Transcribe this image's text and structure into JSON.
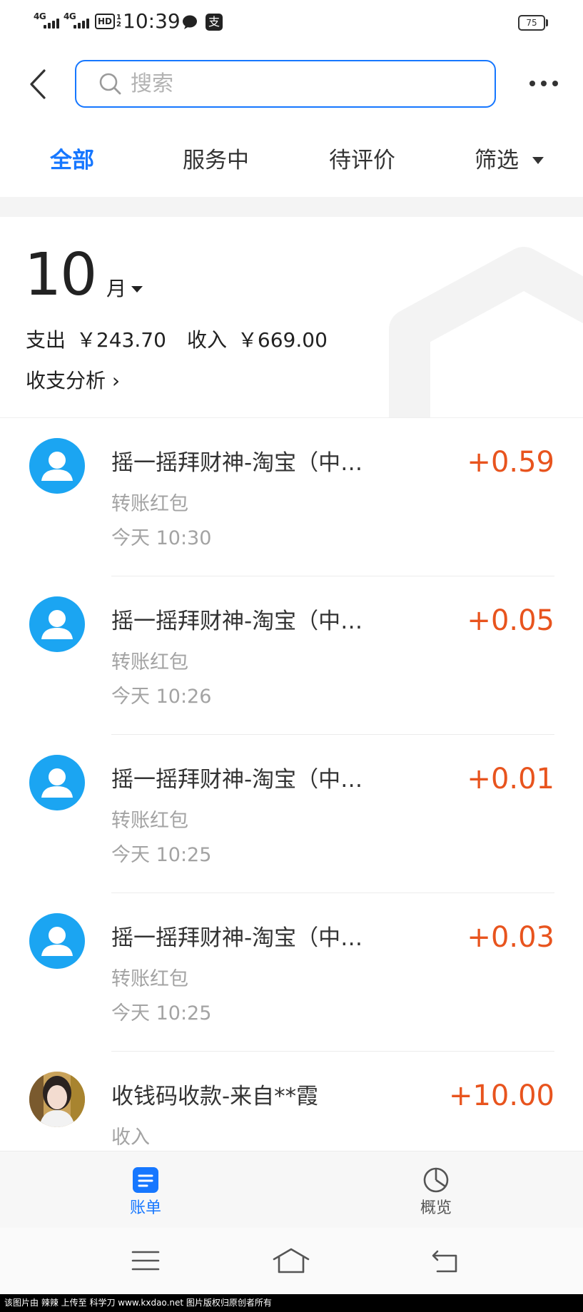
{
  "status_bar": {
    "signal1": "4G",
    "signal2": "4G",
    "hd": "HD",
    "hd_top": "1",
    "hd_bottom": "2",
    "time": "10:39",
    "alipay_glyph": "支",
    "battery": "75"
  },
  "header": {
    "search_placeholder": "搜索"
  },
  "tabs": [
    {
      "label": "全部",
      "active": true
    },
    {
      "label": "服务中",
      "active": false
    },
    {
      "label": "待评价",
      "active": false
    },
    {
      "label": "筛选",
      "active": false
    }
  ],
  "summary": {
    "month_number": "10",
    "month_unit": "月",
    "expense_label": "支出",
    "expense": "￥243.70",
    "income_label": "收入",
    "income": "￥669.00",
    "analysis": "收支分析 ›"
  },
  "transactions": [
    {
      "title": "摇一摇拜财神-淘宝（中…",
      "amount": "+0.59",
      "category": "转账红包",
      "time": "今天  10:30",
      "avatar": "default-user-icon"
    },
    {
      "title": "摇一摇拜财神-淘宝（中…",
      "amount": "+0.05",
      "category": "转账红包",
      "time": "今天  10:26",
      "avatar": "default-user-icon"
    },
    {
      "title": "摇一摇拜财神-淘宝（中…",
      "amount": "+0.01",
      "category": "转账红包",
      "time": "今天  10:25",
      "avatar": "default-user-icon"
    },
    {
      "title": "摇一摇拜财神-淘宝（中…",
      "amount": "+0.03",
      "category": "转账红包",
      "time": "今天  10:25",
      "avatar": "default-user-icon"
    },
    {
      "title": "收钱码收款-来自**霞",
      "amount": "+10.00",
      "category": "收入",
      "avatar": "user-photo"
    }
  ],
  "bottom_tabs": [
    {
      "label": "账单",
      "icon": "bill-icon",
      "active": true
    },
    {
      "label": "概览",
      "icon": "pie-chart-icon",
      "active": false
    }
  ],
  "nav_bar": {
    "icons": [
      "menu-icon",
      "home-icon",
      "back-icon"
    ]
  },
  "watermark": "该图片由 辣辣 上传至 科学刀 www.kxdao.net 图片版权归原创者所有",
  "colors": {
    "accent": "#1677ff",
    "amount": "#e8541e",
    "avatar": "#1ba5f2",
    "muted": "#a3a3a3"
  }
}
